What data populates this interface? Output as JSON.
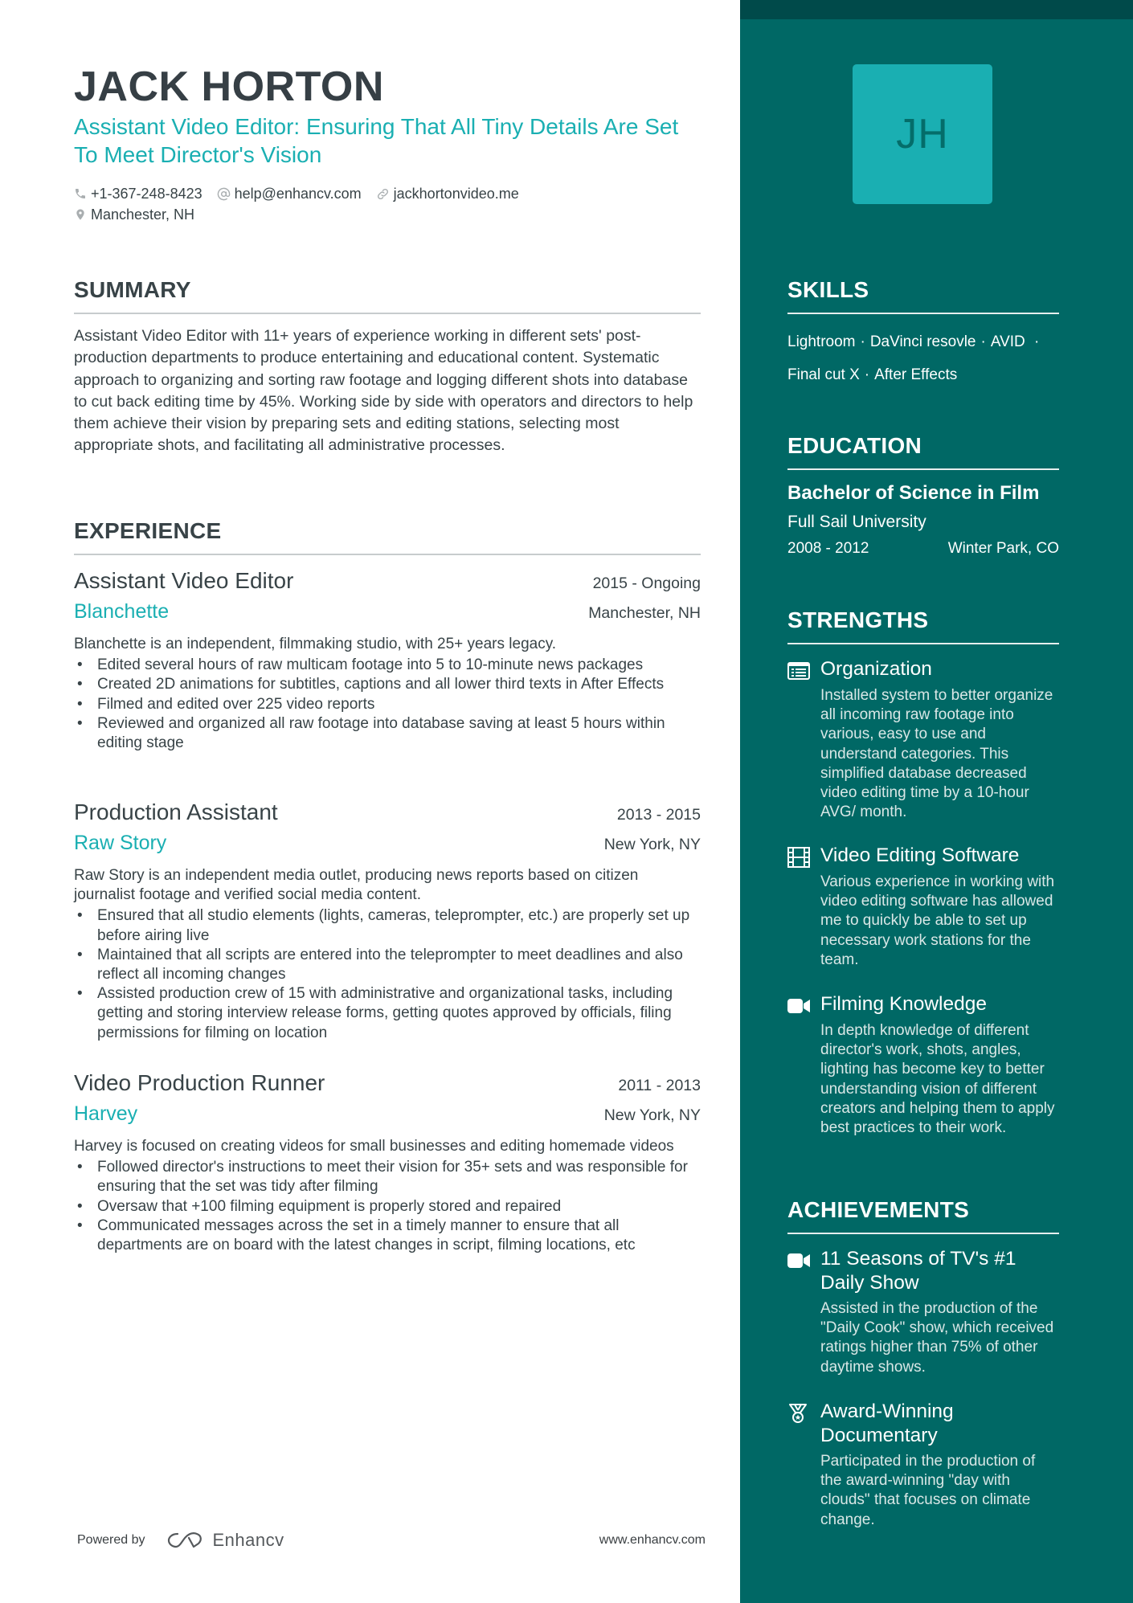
{
  "header": {
    "name": "JACK HORTON",
    "headline": "Assistant Video Editor: Ensuring That All Tiny Details Are Set To Meet Director's Vision",
    "contacts": {
      "phone": {
        "icon": "phone-icon",
        "value": "+1-367-248-8423"
      },
      "email": {
        "icon": "at-icon",
        "value": "help@enhancv.com"
      },
      "website": {
        "icon": "link-icon",
        "value": "jackhortonvideo.me"
      },
      "location": {
        "icon": "map-pin-icon",
        "value": "Manchester, NH"
      }
    }
  },
  "summary": {
    "title": "SUMMARY",
    "text": "Assistant Video Editor with 11+ years of experience working in different sets' post-production departments to produce entertaining and educational content. Systematic approach to organizing and sorting raw footage and logging different shots into database to cut back editing time by 45%. Working side by side with operators and directors to help them achieve their vision by preparing sets and editing stations, selecting most appropriate shots, and facilitating all administrative processes."
  },
  "experience": {
    "title": "EXPERIENCE",
    "jobs": [
      {
        "title": "Assistant Video Editor",
        "dates": "2015 - Ongoing",
        "company": "Blanchette",
        "location": "Manchester, NH",
        "description": "Blanchette is an independent, filmmaking studio, with 25+ years legacy.",
        "bullets": [
          "Edited several hours of raw multicam footage into 5 to 10-minute news packages",
          "Created 2D animations for subtitles, captions and all lower third texts in After Effects",
          "Filmed and edited over 225 video reports",
          "Reviewed and organized all raw footage into database saving at least 5 hours within editing stage"
        ]
      },
      {
        "title": "Production Assistant",
        "dates": "2013 - 2015",
        "company": "Raw Story",
        "location": "New York, NY",
        "description": "Raw Story is an independent media outlet, producing news reports based on citizen journalist footage and verified social media content.",
        "bullets": [
          "Ensured that all studio elements (lights, cameras, teleprompter, etc.) are properly set up before airing live",
          "Maintained that all scripts are entered into the teleprompter to meet deadlines and also reflect all incoming changes",
          "Assisted production crew of 15 with administrative and organizational tasks, including getting and storing interview release forms, getting quotes approved by officials, filing permissions for filming on location"
        ]
      },
      {
        "title": "Video Production Runner",
        "dates": "2011 - 2013",
        "company": "Harvey",
        "location": "New York, NY",
        "description": "Harvey is focused on creating videos for small businesses and editing homemade videos",
        "bullets": [
          "Followed director's instructions to meet their vision for 35+ sets and was responsible for ensuring that the set was tidy after filming",
          "Oversaw that +100 filming equipment is properly stored and repaired",
          "Communicated messages across the set in a timely manner to ensure that all departments are on board with the latest changes in script, filming locations, etc"
        ]
      }
    ]
  },
  "footer": {
    "powered_by": "Powered by",
    "brand": "Enhancv",
    "website": "www.enhancv.com"
  },
  "sidebar": {
    "avatar_initials": "JH",
    "skills": {
      "title": "SKILLS",
      "items": [
        "Lightroom",
        "DaVinci resovle",
        "AVID",
        "Final cut X",
        "After Effects"
      ]
    },
    "education": {
      "title": "EDUCATION",
      "degree": "Bachelor of Science in Film",
      "school": "Full Sail University",
      "dates": "2008 - 2012",
      "location": "Winter Park, CO"
    },
    "strengths": {
      "title": "STRENGTHS",
      "items": [
        {
          "icon": "list-icon",
          "title": "Organization",
          "description": "Installed system to better organize all incoming raw footage into various, easy to use and understand categories. This simplified database decreased video editing time by a 10-hour AVG/ month."
        },
        {
          "icon": "film-strip-icon",
          "title": "Video Editing Software",
          "description": "Various experience in working with video editing software has allowed me to quickly be able to set up necessary work stations for the team."
        },
        {
          "icon": "video-camera-icon",
          "title": "Filming Knowledge",
          "description": "In depth knowledge of different director's work, shots, angles, lighting has become key to better understanding vision of different creators and helping them to apply best practices to their work."
        }
      ]
    },
    "achievements": {
      "title": "ACHIEVEMENTS",
      "items": [
        {
          "icon": "video-camera-icon",
          "title": "11 Seasons of TV's #1 Daily Show",
          "description": "Assisted in the production of the \"Daily Cook\" show, which received ratings higher than 75% of other daytime shows."
        },
        {
          "icon": "medal-icon",
          "title": "Award-Winning Documentary",
          "description": "Participated in the production of the award-winning \"day with clouds\" that focuses on climate change."
        }
      ]
    }
  },
  "colors": {
    "accent": "#1aafb2",
    "sidebar": "#006865",
    "sidebar_top": "#004a4a",
    "text": "#384347"
  }
}
